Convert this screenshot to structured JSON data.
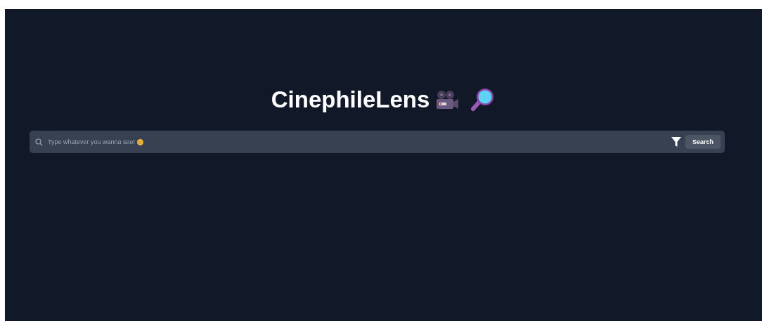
{
  "header": {
    "title": "CinephileLens"
  },
  "search": {
    "placeholder": "Type whatever you wanna see!",
    "button": "Search"
  }
}
